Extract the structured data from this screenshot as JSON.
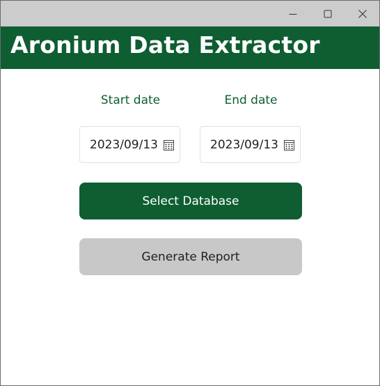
{
  "window": {
    "controls": {
      "minimize_icon": "minimize-icon",
      "maximize_icon": "maximize-icon",
      "close_icon": "close-icon"
    }
  },
  "header": {
    "title": "Aronium Data Extractor"
  },
  "dates": {
    "start": {
      "label": "Start date",
      "value": "2023/09/13",
      "icon": "calendar-icon"
    },
    "end": {
      "label": "End date",
      "value": "2023/09/13",
      "icon": "calendar-icon"
    }
  },
  "actions": {
    "select_database_label": "Select Database",
    "generate_report_label": "Generate Report"
  },
  "colors": {
    "brand_green": "#0e5e32",
    "titlebar": "#cccccc",
    "secondary_button": "#c8c8c8"
  }
}
